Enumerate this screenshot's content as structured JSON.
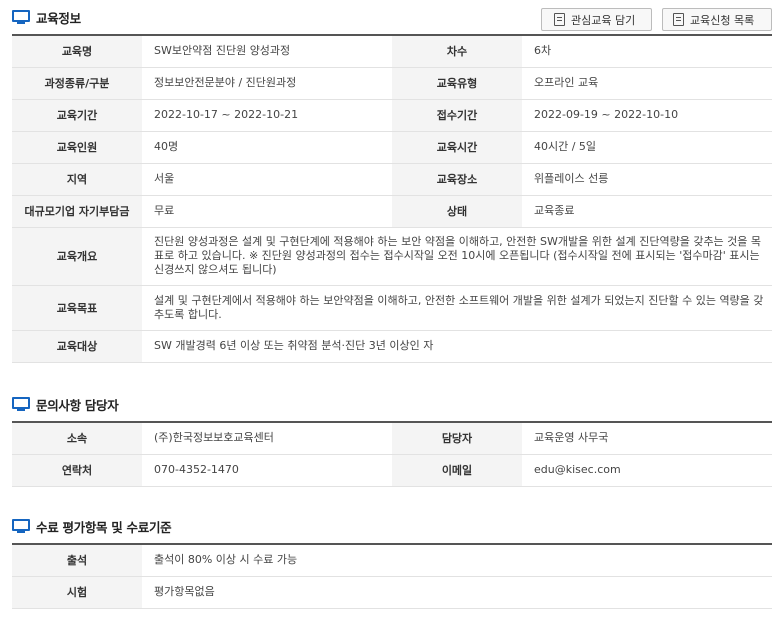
{
  "sections": {
    "edu_info": "교육정보",
    "contact": "문의사항 담당자",
    "evaluation": "수료 평가항목 및 수료기준"
  },
  "buttons": {
    "interest": "관심교육 담기",
    "apply_list": "교육신청 목록"
  },
  "edu": {
    "name_label": "교육명",
    "name": "SW보안약점 진단원 양성과정",
    "round_label": "차수",
    "round": "6차",
    "category_label": "과정종류/구분",
    "category": "정보보안전문분야 / 진단원과정",
    "type_label": "교육유형",
    "type": "오프라인 교육",
    "period_label": "교육기간",
    "period": "2022-10-17 ~ 2022-10-21",
    "apply_period_label": "접수기간",
    "apply_period": "2022-09-19 ~ 2022-10-10",
    "capacity_label": "교육인원",
    "capacity": "40명",
    "hours_label": "교육시간",
    "hours": "40시간 / 5일",
    "region_label": "지역",
    "region": "서울",
    "place_label": "교육장소",
    "place": "위플레이스 선릉",
    "fee_label": "대규모기업 자기부담금",
    "fee": "무료",
    "status_label": "상태",
    "status": "교육종료",
    "overview_label": "교육개요",
    "overview": "진단원 양성과정은 설계 및 구현단계에 적용해야 하는 보안 약점을 이해하고, 안전한 SW개발을 위한 설계 진단역량을 갖추는 것을 목표로 하고 있습니다. ※ 진단원 양성과정의 접수는 접수시작일 오전 10시에 오픈됩니다 (접수시작일 전에 표시되는 '접수마감' 표시는 신경쓰지 않으셔도 됩니다)",
    "goal_label": "교육목표",
    "goal": "설계 및 구현단계에서 적용해야 하는 보안약점을 이해하고, 안전한 소프트웨어 개발을 위한 설계가 되었는지 진단할 수 있는 역량을 갖추도록 합니다.",
    "target_label": "교육대상",
    "target": "SW 개발경력 6년 이상 또는 취약점 분석·진단 3년 이상인 자"
  },
  "contact": {
    "org_label": "소속",
    "org": "(주)한국정보보호교육센터",
    "manager_label": "담당자",
    "manager": "교육운영 사무국",
    "phone_label": "연락처",
    "phone": "070-4352-1470",
    "email_label": "이메일",
    "email": "edu@kisec.com"
  },
  "evaluation": {
    "attendance_label": "출석",
    "attendance": "출석이 80% 이상 시 수료 가능",
    "exam_label": "시험",
    "exam": "평가항목없음"
  }
}
